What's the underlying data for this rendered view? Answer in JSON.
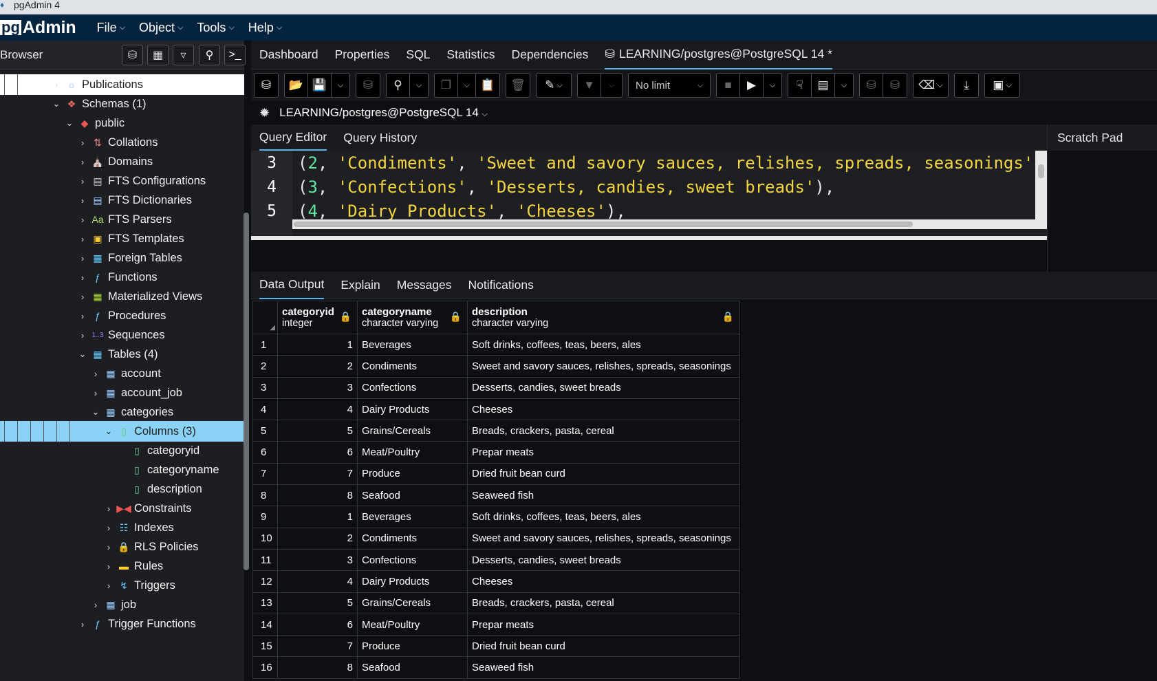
{
  "window": {
    "title": "pgAdmin 4"
  },
  "menubar": {
    "logo_pg": "pg",
    "logo_admin": "Admin",
    "items": [
      {
        "label": "File"
      },
      {
        "label": "Object"
      },
      {
        "label": "Tools"
      },
      {
        "label": "Help"
      }
    ]
  },
  "browser": {
    "title": "Browser",
    "tools": [
      "database-icon",
      "table-grid-icon",
      "filter-table-icon",
      "search-icon",
      "terminal-icon"
    ],
    "nodes": [
      {
        "label": "Publications",
        "level": 3,
        "icon": "publications-icon",
        "expanded": false,
        "highlight": true
      },
      {
        "label": "Schemas (1)",
        "level": 3,
        "icon": "schemas-icon",
        "expanded": true
      },
      {
        "label": "public",
        "level": 4,
        "icon": "schema-icon",
        "expanded": true
      },
      {
        "label": "Collations",
        "level": 5,
        "icon": "collations-icon",
        "expanded": false
      },
      {
        "label": "Domains",
        "level": 5,
        "icon": "domains-icon",
        "expanded": false
      },
      {
        "label": "FTS Configurations",
        "level": 5,
        "icon": "fts-configurations-icon",
        "expanded": false
      },
      {
        "label": "FTS Dictionaries",
        "level": 5,
        "icon": "fts-dictionaries-icon",
        "expanded": false
      },
      {
        "label": "FTS Parsers",
        "level": 5,
        "icon": "fts-parsers-icon",
        "expanded": false
      },
      {
        "label": "FTS Templates",
        "level": 5,
        "icon": "fts-templates-icon",
        "expanded": false
      },
      {
        "label": "Foreign Tables",
        "level": 5,
        "icon": "foreign-tables-icon",
        "expanded": false
      },
      {
        "label": "Functions",
        "level": 5,
        "icon": "functions-icon",
        "expanded": false
      },
      {
        "label": "Materialized Views",
        "level": 5,
        "icon": "materialized-views-icon",
        "expanded": false
      },
      {
        "label": "Procedures",
        "level": 5,
        "icon": "procedures-icon",
        "expanded": false
      },
      {
        "label": "Sequences",
        "level": 5,
        "icon": "sequences-icon",
        "expanded": false
      },
      {
        "label": "Tables (4)",
        "level": 5,
        "icon": "tables-icon",
        "expanded": true
      },
      {
        "label": "account",
        "level": 6,
        "icon": "table-icon",
        "expanded": false
      },
      {
        "label": "account_job",
        "level": 6,
        "icon": "table-icon",
        "expanded": false
      },
      {
        "label": "categories",
        "level": 6,
        "icon": "table-icon",
        "expanded": true
      },
      {
        "label": "Columns (3)",
        "level": 7,
        "icon": "columns-icon",
        "expanded": true,
        "selected": true
      },
      {
        "label": "categoryid",
        "level": 8,
        "icon": "column-icon",
        "leaf": true
      },
      {
        "label": "categoryname",
        "level": 8,
        "icon": "column-icon",
        "leaf": true
      },
      {
        "label": "description",
        "level": 8,
        "icon": "column-icon",
        "leaf": true
      },
      {
        "label": "Constraints",
        "level": 7,
        "icon": "constraints-icon",
        "expanded": false
      },
      {
        "label": "Indexes",
        "level": 7,
        "icon": "indexes-icon",
        "expanded": false
      },
      {
        "label": "RLS Policies",
        "level": 7,
        "icon": "rls-policies-icon",
        "expanded": false
      },
      {
        "label": "Rules",
        "level": 7,
        "icon": "rules-icon",
        "expanded": false
      },
      {
        "label": "Triggers",
        "level": 7,
        "icon": "triggers-icon",
        "expanded": false
      },
      {
        "label": "job",
        "level": 6,
        "icon": "table-icon",
        "expanded": false
      },
      {
        "label": "Trigger Functions",
        "level": 5,
        "icon": "trigger-functions-icon",
        "expanded": false
      }
    ]
  },
  "main_tabs": [
    {
      "label": "Dashboard"
    },
    {
      "label": "Properties"
    },
    {
      "label": "SQL"
    },
    {
      "label": "Statistics"
    },
    {
      "label": "Dependencies"
    },
    {
      "label": "LEARNING/postgres@PostgreSQL 14 *",
      "active": true
    }
  ],
  "toolbar": {
    "limit_value": "No limit"
  },
  "connection": {
    "label": "LEARNING/postgres@PostgreSQL 14"
  },
  "query_tabs": [
    {
      "label": "Query Editor",
      "active": true
    },
    {
      "label": "Query History"
    }
  ],
  "scratch_pad": {
    "title": "Scratch Pad"
  },
  "code_lines": [
    {
      "num": "3",
      "tokens": [
        [
          "p",
          "("
        ],
        [
          "n",
          "2"
        ],
        [
          "p",
          ", "
        ],
        [
          "s",
          "'Condiments'"
        ],
        [
          "p",
          ", "
        ],
        [
          "s",
          "'Sweet and savory sauces, relishes, spreads, seasonings'"
        ],
        [
          "p",
          "),"
        ]
      ]
    },
    {
      "num": "4",
      "tokens": [
        [
          "p",
          "("
        ],
        [
          "n",
          "3"
        ],
        [
          "p",
          ", "
        ],
        [
          "s",
          "'Confections'"
        ],
        [
          "p",
          ", "
        ],
        [
          "s",
          "'Desserts, candies, sweet breads'"
        ],
        [
          "p",
          "),"
        ]
      ]
    },
    {
      "num": "5",
      "tokens": [
        [
          "p",
          "("
        ],
        [
          "n",
          "4"
        ],
        [
          "p",
          ", "
        ],
        [
          "s",
          "'Dairy Products'"
        ],
        [
          "p",
          ", "
        ],
        [
          "s",
          "'Cheeses'"
        ],
        [
          "p",
          "),"
        ]
      ]
    }
  ],
  "output_tabs": [
    {
      "label": "Data Output",
      "active": true
    },
    {
      "label": "Explain"
    },
    {
      "label": "Messages"
    },
    {
      "label": "Notifications"
    }
  ],
  "grid": {
    "columns": [
      {
        "name": "categoryid",
        "type": "integer"
      },
      {
        "name": "categoryname",
        "type": "character varying"
      },
      {
        "name": "description",
        "type": "character varying"
      }
    ],
    "rows": [
      [
        "1",
        "1",
        "Beverages",
        "Soft drinks, coffees, teas, beers, ales"
      ],
      [
        "2",
        "2",
        "Condiments",
        "Sweet and savory sauces, relishes, spreads, seasonings"
      ],
      [
        "3",
        "3",
        "Confections",
        "Desserts, candies, sweet breads"
      ],
      [
        "4",
        "4",
        "Dairy Products",
        "Cheeses"
      ],
      [
        "5",
        "5",
        "Grains/Cereals",
        "Breads, crackers, pasta, cereal"
      ],
      [
        "6",
        "6",
        "Meat/Poultry",
        "Prepar meats"
      ],
      [
        "7",
        "7",
        "Produce",
        "Dried fruit bean curd"
      ],
      [
        "8",
        "8",
        "Seafood",
        "Seaweed fish"
      ],
      [
        "9",
        "1",
        "Beverages",
        "Soft drinks, coffees, teas, beers, ales"
      ],
      [
        "10",
        "2",
        "Condiments",
        "Sweet and savory sauces, relishes, spreads, seasonings"
      ],
      [
        "11",
        "3",
        "Confections",
        "Desserts, candies, sweet breads"
      ],
      [
        "12",
        "4",
        "Dairy Products",
        "Cheeses"
      ],
      [
        "13",
        "5",
        "Grains/Cereals",
        "Breads, crackers, pasta, cereal"
      ],
      [
        "14",
        "6",
        "Meat/Poultry",
        "Prepar meats"
      ],
      [
        "15",
        "7",
        "Produce",
        "Dried fruit bean curd"
      ],
      [
        "16",
        "8",
        "Seafood",
        "Seaweed fish"
      ]
    ]
  },
  "colors": {
    "accent": "#53b9ee",
    "selected": "#8ad3f7",
    "menubar": "#03233f",
    "number": "#5ee8a0",
    "string": "#f3d43f"
  }
}
